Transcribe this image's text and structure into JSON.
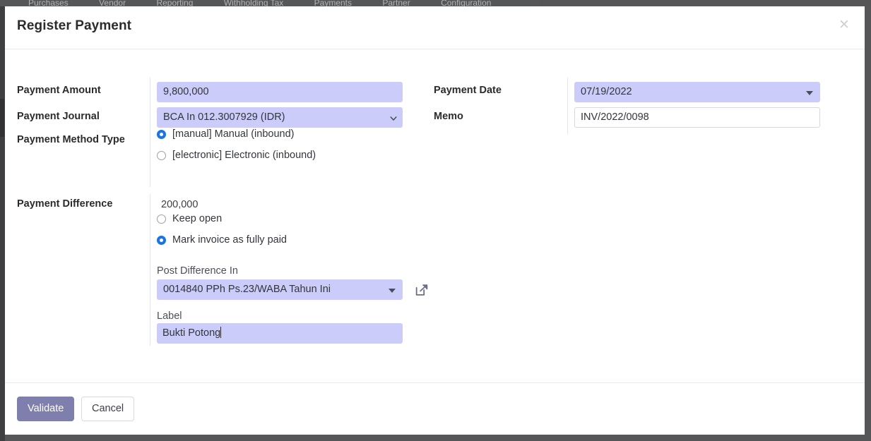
{
  "background": {
    "menu_items": [
      "Purchases",
      "Vendor",
      "Reporting",
      "Withholding Tax",
      "Payments",
      "Partner",
      "Configuration"
    ]
  },
  "dialog": {
    "title": "Register Payment",
    "close_icon": "close-icon",
    "fields": {
      "payment_amount_label": "Payment Amount",
      "payment_amount_value": "9,800,000",
      "payment_journal_label": "Payment Journal",
      "payment_journal_value": "BCA In 012.3007929 (IDR)",
      "payment_method_type_label": "Payment Method Type",
      "payment_method_options": [
        {
          "label": "[manual] Manual (inbound)",
          "selected": true
        },
        {
          "label": "[electronic] Electronic (inbound)",
          "selected": false
        }
      ],
      "payment_date_label": "Payment Date",
      "payment_date_value": "07/19/2022",
      "memo_label": "Memo",
      "memo_value": "INV/2022/0098",
      "payment_difference_label": "Payment Difference",
      "payment_difference_value": "200,000",
      "payment_difference_options": [
        {
          "label": "Keep open",
          "selected": false
        },
        {
          "label": "Mark invoice as fully paid",
          "selected": true
        }
      ],
      "post_difference_in_label": "Post Difference In",
      "post_difference_in_value": "0014840 PPh Ps.23/WABA Tahun Ini",
      "post_difference_external_link_icon": "external-link-icon",
      "label_label": "Label",
      "label_value": "Bukti Potong"
    },
    "footer": {
      "validate_label": "Validate",
      "cancel_label": "Cancel"
    }
  },
  "colors": {
    "accent_primary": "#7f7fad",
    "field_selected_bg": "#ccccfa",
    "radio_on": "#1a73e8",
    "text_primary": "#2b2b2b",
    "border": "#e7e9ed"
  }
}
